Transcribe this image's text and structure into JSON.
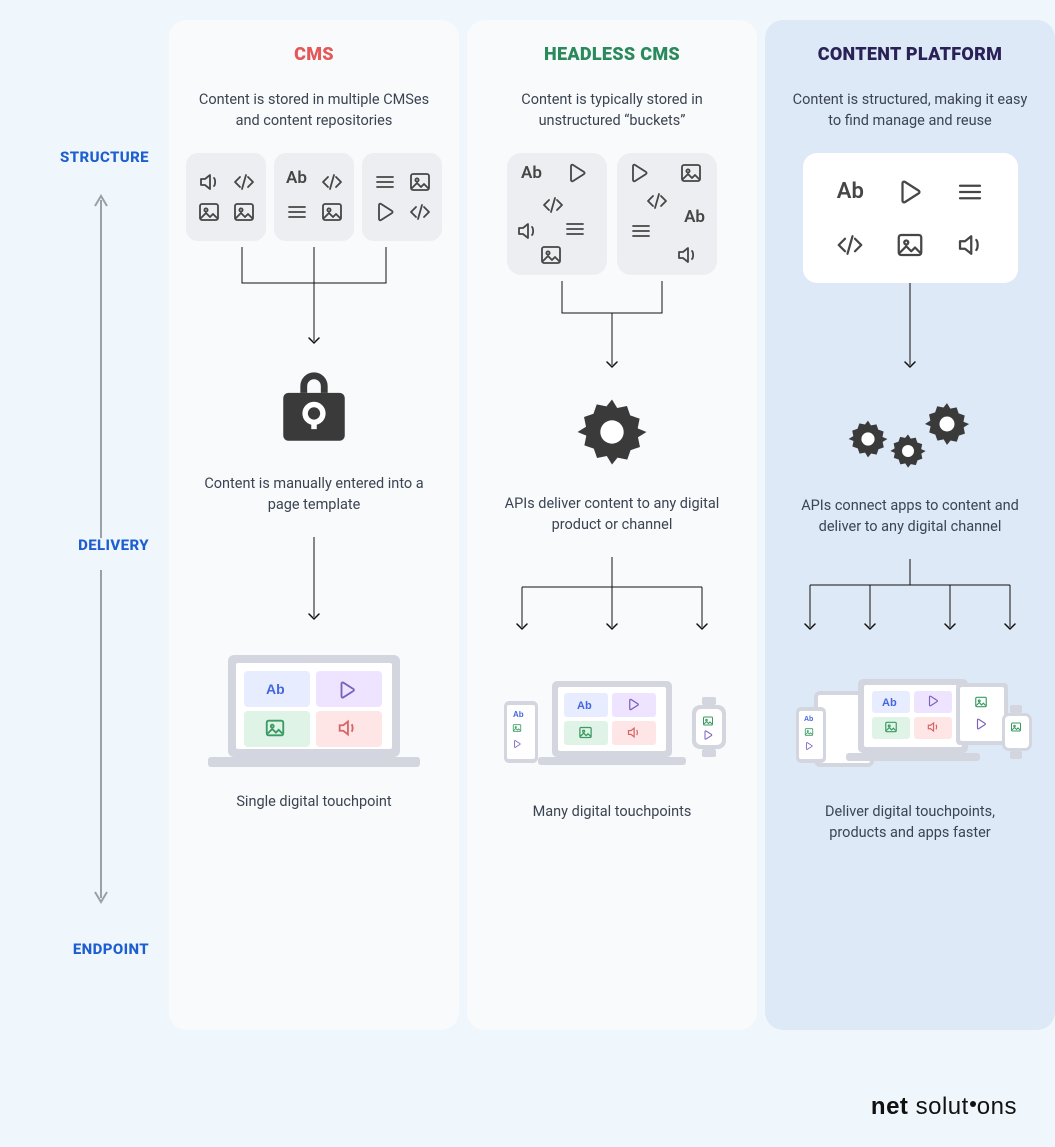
{
  "row_labels": {
    "structure": "STRUCTURE",
    "delivery": "DELIVERY",
    "endpoint": "ENDPOINT"
  },
  "columns": {
    "cms": {
      "title": "CMS",
      "structure_desc": "Content is stored in multiple CMSes and content repositories",
      "delivery_desc": "Content is manually entered into a page template",
      "endpoint_desc": "Single digital touchpoint"
    },
    "headless": {
      "title": "HEADLESS CMS",
      "structure_desc": "Content is typically stored in unstructured “buckets”",
      "delivery_desc": "APIs deliver content to any digital product or channel",
      "endpoint_desc": "Many digital touchpoints"
    },
    "platform": {
      "title": "CONTENT PLATFORM",
      "structure_desc": "Content is structured, making it easy to find manage and reuse",
      "delivery_desc": "APIs connect apps to content and deliver to any digital channel",
      "endpoint_desc": "Deliver digital touchpoints, products and apps faster"
    }
  },
  "icons": {
    "text": "Ab",
    "ab_label": "Ab"
  },
  "brand": {
    "bold": "net",
    "light": "solut",
    "light2": "ons"
  }
}
